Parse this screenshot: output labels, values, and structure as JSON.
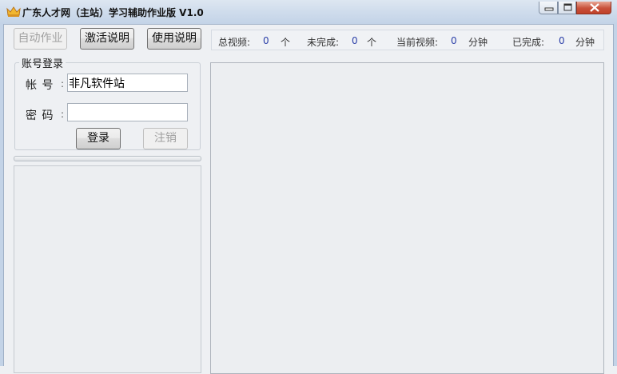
{
  "window": {
    "title": "广东人才网（主站）学习辅助作业版 V1.0"
  },
  "toolbar": {
    "auto_label": "自动作业",
    "activate_label": "激活说明",
    "usage_label": "使用说明"
  },
  "status": {
    "total_label": "总视频:",
    "total_value": "0",
    "total_unit": "个",
    "unfinished_label": "未完成:",
    "unfinished_value": "0",
    "unfinished_unit": "个",
    "current_label": "当前视频:",
    "current_value": "0",
    "current_unit": "分钟",
    "done_label": "已完成:",
    "done_value": "0",
    "done_unit": "分钟"
  },
  "login": {
    "group_title": "账号登录",
    "account_label": "帐 号",
    "account_value": "非凡软件站",
    "password_label": "密 码",
    "password_value": "",
    "colon": ":",
    "login_label": "登录",
    "logout_label": "注销"
  },
  "progress": {
    "value": 0
  },
  "colors": {
    "titlebar": "#cfdcec",
    "background": "#eef0f3",
    "number": "#2b3fa8",
    "close_button": "#c8503a"
  },
  "icons": {
    "app": "crown-icon",
    "minimize": "minimize-icon",
    "maximize": "maximize-icon",
    "close": "close-icon"
  }
}
